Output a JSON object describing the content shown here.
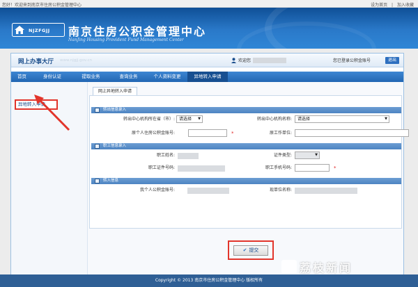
{
  "topbar": {
    "welcome": "您好！欢迎来到南京市住房公积金管理中心",
    "link_home": "设为首页",
    "link_sep": "|",
    "link_favorite": "加入收藏"
  },
  "banner": {
    "logo_abbr": "NJZFGJJ",
    "title": "南京住房公积金管理中心",
    "subtitle": "NanJing Housing Provident Fund Management Center"
  },
  "header": {
    "hall_title": "网上办事大厅",
    "hall_url": "www.njgjj.gov.cn",
    "welcome_label": "欢迎您",
    "account_text": "您已登录公积金账号",
    "logout_label": "退出"
  },
  "nav": {
    "items": [
      {
        "label": "首页"
      },
      {
        "label": "身份认证"
      },
      {
        "label": "提取业务"
      },
      {
        "label": "查询业务"
      },
      {
        "label": "个人资料变更"
      },
      {
        "label": "异地转入申请"
      }
    ]
  },
  "sidebar": {
    "items": [
      {
        "label": "异地转入申请"
      }
    ]
  },
  "main": {
    "tab_label": "网上异地转入申请",
    "sections": {
      "transfer_out": "转出信息录入",
      "employee": "职工信息录入",
      "transfer_in": "转入信息"
    },
    "fields": {
      "out_province_label": "转出中心机构所在省（市）:",
      "out_province_value": "请选择",
      "out_center_label": "转出中心机构名称:",
      "out_center_value": "请选择",
      "orig_account_label": "原个人住房公积金账号:",
      "orig_employer_label": "原工作单位:",
      "employee_name_label": "职工姓名:",
      "id_type_label": "证件类型:",
      "id_number_label": "职工证件号码:",
      "phone_label": "职工手机号码:",
      "my_account_label": "我个人公积金账号:",
      "current_employer_label": "现单位名称:"
    },
    "required_mark": "*",
    "submit_label": "提交"
  },
  "footer": {
    "text": "Copyright © 2013 南京市住房公积金管理中心 版权所有"
  },
  "watermark": {
    "text": "荔枝新闻"
  },
  "colors": {
    "nav_blue": "#2266b3",
    "banner_blue": "#2a79c9",
    "highlight_red": "#e2352b",
    "required_red": "#e02020"
  }
}
